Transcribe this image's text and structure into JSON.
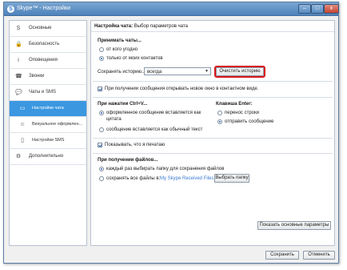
{
  "window": {
    "title": "Skype™ - Настройки",
    "app_glyph": "S",
    "controls": {
      "minimize": "–",
      "maximize": "□",
      "close": "x"
    }
  },
  "sidebar": {
    "items": [
      {
        "label": "Основные",
        "icon": "skype-icon",
        "glyph": "S"
      },
      {
        "label": "Безопасность",
        "icon": "lock-icon",
        "glyph": "🔒"
      },
      {
        "label": "Оповещения",
        "icon": "info-icon",
        "glyph": "i"
      },
      {
        "label": "Звонки",
        "icon": "phone-icon",
        "glyph": "☎"
      },
      {
        "label": "Чаты и SMS",
        "icon": "chat-icon",
        "glyph": "💬"
      },
      {
        "label": "Настройки чата",
        "icon": "chat-bubble-icon",
        "glyph": "▭",
        "active": true
      },
      {
        "label": "Визуальное оформлен...",
        "icon": "smiley-icon",
        "glyph": "☺"
      },
      {
        "label": "Настройки SMS",
        "icon": "sms-icon",
        "glyph": "▯"
      },
      {
        "label": "Дополнительно",
        "icon": "gear-icon",
        "glyph": "⚙"
      }
    ]
  },
  "header": {
    "title_bold": "Настройка чата:",
    "title_rest": " Выбор параметров чата"
  },
  "accept_chats": {
    "title": "Принимать чаты...",
    "options": [
      "от кого угодно",
      "только от моих контактов"
    ],
    "selected": 1
  },
  "history": {
    "label": "Сохранять историю...",
    "value": "всегда",
    "clear_button": "Очистить историю"
  },
  "open_new_window": {
    "label": "При получении сообщения открывать новое окно в контактном виде.",
    "checked": true
  },
  "ctrl_v": {
    "title": "При нажатии Ctrl+V...",
    "options": [
      "оформленное сообщение вставляется как цитата",
      "сообщение вставляется как обычный текст"
    ],
    "option0_lines": [
      "оформленное сообщение вставляется как",
      "цитата"
    ],
    "selected": 0
  },
  "enter_key": {
    "title": "Клавиша Enter:",
    "options": [
      "перенос строки",
      "отправить сообщение"
    ],
    "selected": 1
  },
  "show_typing": {
    "label": "Показывать, что я печатаю",
    "checked": true
  },
  "file_receive": {
    "title": "При получении файлов...",
    "options": [
      "каждый раз выбирать папку для сохранения файлов",
      "сохранять все файлы в:"
    ],
    "folder_link": "My Skype Received Files",
    "choose_button": "Выбрать папку",
    "selected": 0
  },
  "advanced_button": "Показать основные параметры",
  "footer": {
    "save": "Сохранить",
    "cancel": "Отменить"
  },
  "colors": {
    "accent": "#3a97e0",
    "highlight": "#d9161b",
    "link": "#3a7bd5"
  }
}
